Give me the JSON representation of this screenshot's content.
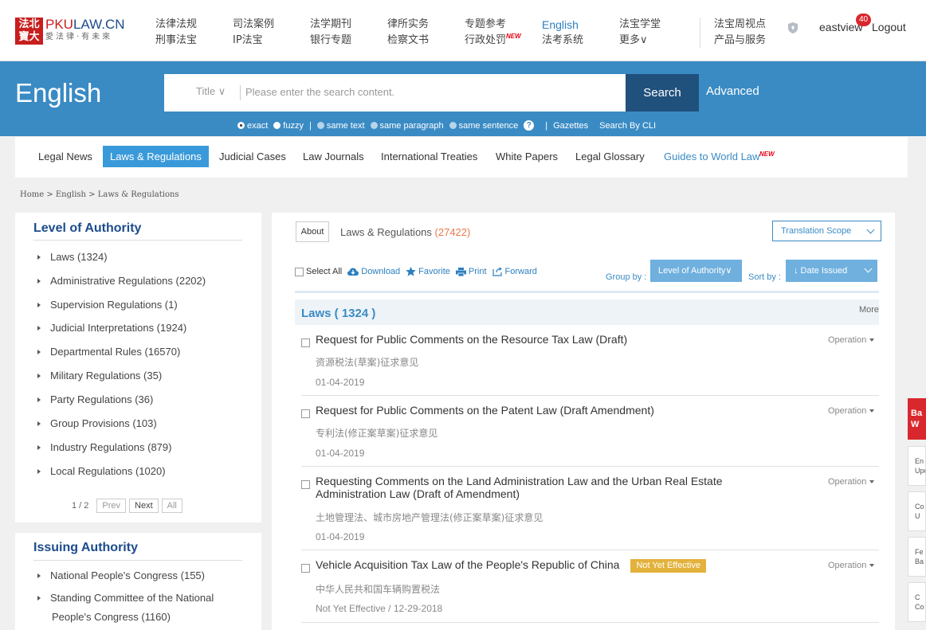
{
  "brand": {
    "seal": "法北\n寶大",
    "name_prefix": "PKU",
    "name": "LAW.CN",
    "tagline": "愛法律·有未來"
  },
  "topnav": {
    "cols": [
      {
        "top": "法律法规",
        "bottom": "刑事法宝"
      },
      {
        "top": "司法案例",
        "bottom": "IP法宝"
      },
      {
        "top": "法学期刊",
        "bottom": "银行专题"
      },
      {
        "top": "律所实务",
        "bottom": "检察文书"
      },
      {
        "top": "专题参考",
        "bottom": "行政处罚",
        "new": "NEW"
      },
      {
        "top": "English",
        "bottom": "法考系统"
      },
      {
        "top": "法宝学堂",
        "bottom": "更多∨"
      },
      {
        "top": "法宝周视点",
        "bottom": "产品与服务"
      }
    ],
    "user": "eastview",
    "badge": "40",
    "logout": "Logout"
  },
  "search": {
    "title": "English",
    "scope": "Title ∨",
    "placeholder": "Please enter the search content.",
    "button": "Search",
    "advanced": "Advanced",
    "options": {
      "exact": "exact",
      "fuzzy": "fuzzy",
      "bar": "|",
      "same_text": "same text",
      "same_paragraph": "same paragraph",
      "same_sentence": "same sentence",
      "help": "?",
      "gazettes": "Gazettes",
      "by_cli": "Search By CLI"
    }
  },
  "categories": [
    "Legal News",
    "Laws & Regulations",
    "Judicial Cases",
    "Law Journals",
    "International Treaties",
    "White Papers",
    "Legal Glossary",
    "Guides to World Law"
  ],
  "category_new": "NEW",
  "breadcrumb": "Home > English > Laws & Regulations",
  "authority": {
    "title": "Level of Authority",
    "items": [
      "Laws (1324)",
      "Administrative Regulations (2202)",
      "Supervision Regulations (1)",
      "Judicial Interpretations (1924)",
      "Departmental Rules (16570)",
      "Military Regulations (35)",
      "Party Regulations (36)",
      "Group Provisions (103)",
      "Industry Regulations (879)",
      "Local Regulations (1020)"
    ],
    "pager": {
      "page": "1 / 2",
      "prev": "Prev",
      "next": "Next",
      "all": "All"
    }
  },
  "issuing": {
    "title": "Issuing Authority",
    "items": [
      "National People's Congress (155)",
      "Standing Committee of the National",
      "People's Congress (1160)"
    ]
  },
  "main": {
    "about": "About",
    "title": "Laws & Regulations",
    "count": "(27422)",
    "scope": "Translation Scope",
    "toolbar": {
      "select_all": "Select All",
      "download": "Download",
      "favorite": "Favorite",
      "print": "Print",
      "forward": "Forward",
      "group_by": "Group by :",
      "group_value": "Level of Authority∨",
      "sort_by": "Sort by :",
      "sort_value": "↓ Date Issued"
    },
    "section": {
      "title": "Laws ( 1324 )",
      "more": "More"
    },
    "operation": "Operation",
    "results": [
      {
        "title": "Request for Public Comments on the Resource Tax Law (Draft)",
        "cn": "资源税法(草案)征求意见",
        "date": "01-04-2019"
      },
      {
        "title": "Request for Public Comments on the Patent Law (Draft Amendment)",
        "cn": "专利法(修正案草案)征求意见",
        "date": "01-04-2019"
      },
      {
        "title": "Requesting Comments on the Land Administration Law and the Urban Real Estate Administration Law (Draft of Amendment)",
        "cn": "土地管理法、城市房地产管理法(修正案草案)征求意见",
        "date": "01-04-2019"
      },
      {
        "title": "Vehicle Acquisition Tax Law of the People's Republic of China",
        "badge": "Not Yet Effective",
        "cn": "中华人民共和国车辆购置税法",
        "date": "Not Yet Effective / 12-29-2018"
      }
    ]
  },
  "side": {
    "top": "Ba\nW",
    "cells": [
      "En\nUpd",
      "Co\nU",
      "Fe\nBa",
      "C\nCo"
    ]
  },
  "colors": {
    "accent": "#3a8bc4",
    "dark": "#20507c",
    "brand_red": "#c81e1e"
  }
}
